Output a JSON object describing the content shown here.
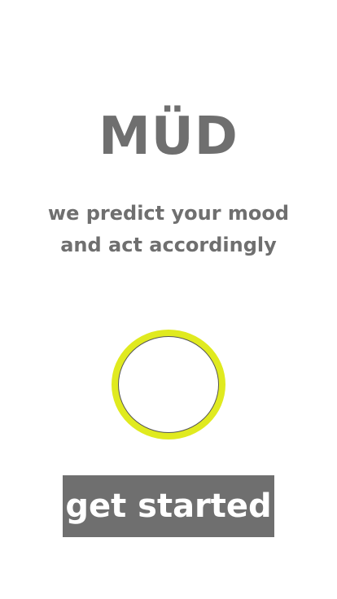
{
  "app": {
    "title": "MÜD",
    "tagline": "we predict your mood and act accordingly"
  },
  "indicator": {
    "icon": "circle-outline-icon",
    "ring_color": "#e0ea1f",
    "fill_color": "#ffffff"
  },
  "cta": {
    "label": "get started"
  },
  "colors": {
    "text": "#6f6f6f",
    "button_background": "#6f6f6f",
    "button_text": "#ffffff",
    "accent": "#e0ea1f"
  }
}
